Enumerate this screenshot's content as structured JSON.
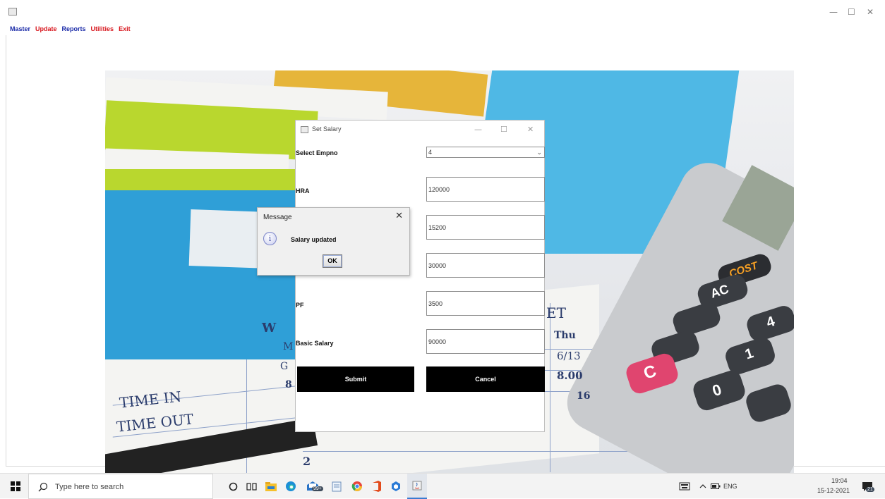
{
  "menu": {
    "items": [
      {
        "label": "Master",
        "color": "#1a2aa8"
      },
      {
        "label": "Update",
        "color": "#d8161d"
      },
      {
        "label": "Reports",
        "color": "#1a2aa8"
      },
      {
        "label": "Utilities",
        "color": "#d8161d"
      },
      {
        "label": "Exit",
        "color": "#d8161d"
      }
    ]
  },
  "window_controls": {
    "minimize": "—",
    "maximize": "☐",
    "close": "✕"
  },
  "background_text": {
    "time_in": "TIME IN",
    "time_out": "TIME OUT",
    "wt": "W",
    "m": "M",
    "g": "G",
    "eight": "8",
    "thu": "Thu",
    "date": "6/13",
    "amount": "8.00",
    "sixteen": "16",
    "two": "2",
    "et": "ET",
    "cost_key": "COST",
    "ac_key": "AC",
    "c_key": "C",
    "zero_key": "0",
    "one_key": "1",
    "four_key": "4"
  },
  "dialog": {
    "title": "Set Salary",
    "controls": {
      "minimize": "—",
      "maximize": "☐",
      "close": "✕"
    },
    "fields": {
      "empno_label": "Select Empno",
      "empno_value": "4",
      "hra_label": "HRA",
      "hra_value": "120000",
      "field2_value": "15200",
      "field3_value": "30000",
      "pf_label": "PF",
      "pf_value": "3500",
      "basic_label": "Basic Salary",
      "basic_value": "90000"
    },
    "submit_label": "Submit",
    "cancel_label": "Cancel"
  },
  "message_box": {
    "title": "Message",
    "close": "✕",
    "icon": "info-icon",
    "text": "Salary updated",
    "ok_label": "OK"
  },
  "taskbar": {
    "search_placeholder": "Type here to search",
    "mail_badge": "99+",
    "language": "ENG",
    "time": "19:04",
    "date": "15-12-2021",
    "notification_count": "21"
  }
}
